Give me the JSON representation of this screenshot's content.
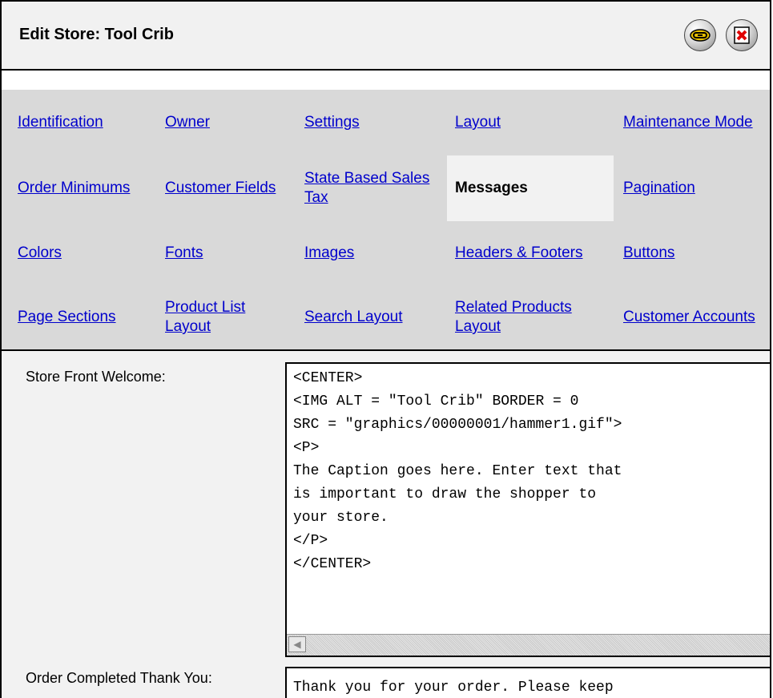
{
  "header": {
    "title": "Edit Store: Tool Crib",
    "link_icon": "chain-link-icon",
    "close_icon": "close-window-icon"
  },
  "tabs": [
    {
      "label": "Identification",
      "active": false
    },
    {
      "label": "Owner",
      "active": false
    },
    {
      "label": "Settings",
      "active": false
    },
    {
      "label": "Layout",
      "active": false
    },
    {
      "label": "Maintenance Mode",
      "active": false
    },
    {
      "label": "Order Minimums",
      "active": false
    },
    {
      "label": "Customer Fields",
      "active": false
    },
    {
      "label": "State Based Sales Tax",
      "active": false
    },
    {
      "label": "Messages",
      "active": true
    },
    {
      "label": "Pagination",
      "active": false
    },
    {
      "label": "Colors",
      "active": false
    },
    {
      "label": "Fonts",
      "active": false
    },
    {
      "label": "Images",
      "active": false
    },
    {
      "label": "Headers & Footers",
      "active": false
    },
    {
      "label": "Buttons",
      "active": false
    },
    {
      "label": "Page Sections",
      "active": false
    },
    {
      "label": "Product List Layout",
      "active": false
    },
    {
      "label": "Search Layout",
      "active": false
    },
    {
      "label": "Related Products Layout",
      "active": false
    },
    {
      "label": "Customer Accounts",
      "active": false
    }
  ],
  "fields": {
    "welcome": {
      "label": "Store Front Welcome:",
      "value": "<CENTER>\n<IMG ALT = \"Tool Crib\" BORDER = 0\nSRC = \"graphics/00000001/hammer1.gif\">\n<P>\nThe Caption goes here. Enter text that\nis important to draw the shopper to\nyour store.\n</P>\n</CENTER>"
    },
    "thank_you": {
      "label": "Order Completed Thank You:",
      "value": "Thank you for your order. Please keep"
    }
  },
  "colors": {
    "link": "#0000cc",
    "tab_bar_bg": "#d9d9d9",
    "active_tab_bg": "#f2f2f2"
  }
}
